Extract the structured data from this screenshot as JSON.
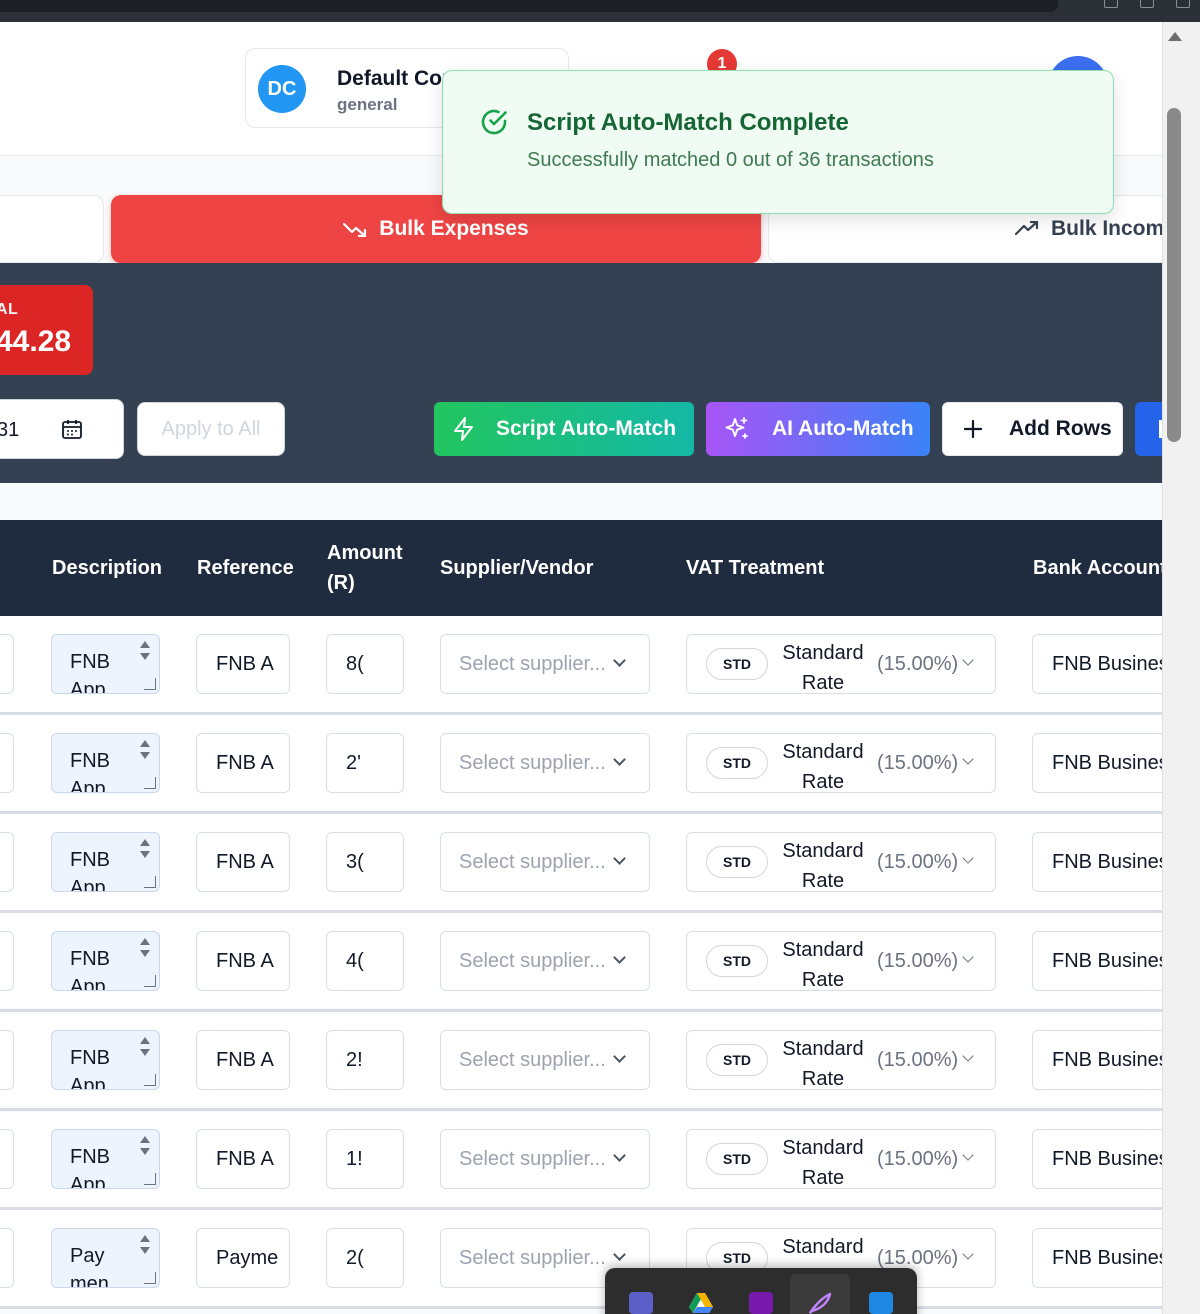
{
  "header": {
    "company_initials": "DC",
    "company_name": "Default Cor",
    "company_sub": "general",
    "notification_count": "1"
  },
  "toast": {
    "title": "Script Auto-Match Complete",
    "message": "Successfully matched 0 out of 36 transactions"
  },
  "tabs": {
    "expenses": "Bulk Expenses",
    "income": "Bulk Income"
  },
  "summary": {
    "total_label": "AL",
    "total_value": "44.28"
  },
  "toolbar": {
    "date_value": "31",
    "apply_label": "Apply to All",
    "script_label": "Script Auto-Match",
    "ai_label": "AI Auto-Match",
    "add_label": "Add Rows"
  },
  "table": {
    "headers": {
      "description": "Description",
      "reference": "Reference",
      "amount_line1": "Amount",
      "amount_line2": "(R)",
      "supplier": "Supplier/Vendor",
      "vat": "VAT Treatment",
      "bank": "Bank Account"
    },
    "rows": [
      {
        "desc": "FNB",
        "desc2": "App",
        "ref": "FNB A",
        "amount": "8(",
        "supplier": "Select supplier...",
        "vat_code": "STD",
        "vat_name": "Standard Rate",
        "vat_rate": "(15.00%)",
        "bank": "FNB Busines"
      },
      {
        "desc": "FNB",
        "desc2": "App",
        "ref": "FNB A",
        "amount": "2'",
        "supplier": "Select supplier...",
        "vat_code": "STD",
        "vat_name": "Standard Rate",
        "vat_rate": "(15.00%)",
        "bank": "FNB Busines"
      },
      {
        "desc": "FNB",
        "desc2": "App",
        "ref": "FNB A",
        "amount": "3(",
        "supplier": "Select supplier...",
        "vat_code": "STD",
        "vat_name": "Standard Rate",
        "vat_rate": "(15.00%)",
        "bank": "FNB Busines"
      },
      {
        "desc": "FNB",
        "desc2": "App",
        "ref": "FNB A",
        "amount": "4(",
        "supplier": "Select supplier...",
        "vat_code": "STD",
        "vat_name": "Standard Rate",
        "vat_rate": "(15.00%)",
        "bank": "FNB Busines"
      },
      {
        "desc": "FNB",
        "desc2": "App",
        "ref": "FNB A",
        "amount": "2!",
        "supplier": "Select supplier...",
        "vat_code": "STD",
        "vat_name": "Standard Rate",
        "vat_rate": "(15.00%)",
        "bank": "FNB Busines"
      },
      {
        "desc": "FNB",
        "desc2": "App",
        "ref": "FNB A",
        "amount": "1!",
        "supplier": "Select supplier...",
        "vat_code": "STD",
        "vat_name": "Standard Rate",
        "vat_rate": "(15.00%)",
        "bank": "FNB Busines"
      },
      {
        "desc": "Pay",
        "desc2": "men",
        "ref": "Payme",
        "amount": "2(",
        "supplier": "Select supplier...",
        "vat_code": "STD",
        "vat_name": "Standard Rate",
        "vat_rate": "(15.00%)",
        "bank": "FNB Busines"
      }
    ]
  },
  "taskbar": {
    "icons": [
      "teams-icon",
      "google-drive-icon",
      "onenote-icon",
      "feather-app-icon",
      "store-icon"
    ]
  },
  "colors": {
    "expenses_tab": "#ef4444",
    "panel": "#344153",
    "table_header": "#1f2b3e",
    "toast_bg": "#effbf3",
    "toast_title": "#166534"
  }
}
